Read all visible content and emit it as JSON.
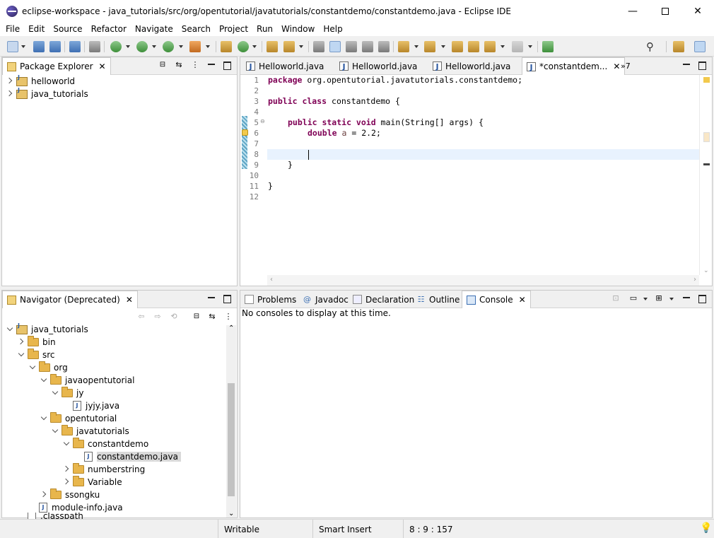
{
  "window": {
    "title": "eclipse-workspace - java_tutorials/src/org/opentutorial/javatutorials/constantdemo/constantdemo.java - Eclipse IDE",
    "minimize": "—",
    "close": "✕"
  },
  "menu": [
    "File",
    "Edit",
    "Source",
    "Refactor",
    "Navigate",
    "Search",
    "Project",
    "Run",
    "Window",
    "Help"
  ],
  "package_explorer": {
    "title": "Package Explorer",
    "items": [
      "helloworld",
      "java_tutorials"
    ]
  },
  "editor": {
    "tabs": [
      "Helloworld.java",
      "Helloworld.java",
      "Helloworld.java",
      "*constantdem..."
    ],
    "overflow": "»7",
    "lines": [
      "1",
      "2",
      "3",
      "4",
      "5",
      "6",
      "7",
      "8",
      "9",
      "10",
      "11",
      "12"
    ],
    "code": {
      "l1_kw": "package",
      "l1_rest": " org.opentutorial.javatutorials.constantdemo;",
      "l3_kw": "public class",
      "l3_rest": " constantdemo {",
      "l5_kw": "public static void",
      "l5_rest": " main(String[] args) {",
      "l6_kw": "double",
      "l6_var": "a",
      "l6_rest": " = 2.2;",
      "l9": "}",
      "l11": "}"
    }
  },
  "navigator": {
    "title": "Navigator (Deprecated)",
    "tree": [
      "java_tutorials",
      "bin",
      "src",
      "org",
      "javaopentutorial",
      "jy",
      "jyjy.java",
      "opentutorial",
      "javatutorials",
      "constantdemo",
      "constantdemo.java",
      "numberstring",
      "Variable",
      "ssongku",
      "module-info.java",
      ".classpath"
    ]
  },
  "bottom_panel": {
    "tabs": [
      "Problems",
      "Javadoc",
      "Declaration",
      "Outline",
      "Console"
    ],
    "console_message": "No consoles to display at this time."
  },
  "status": {
    "writable": "Writable",
    "insert_mode": "Smart Insert",
    "position": "8 : 9 : 157"
  }
}
